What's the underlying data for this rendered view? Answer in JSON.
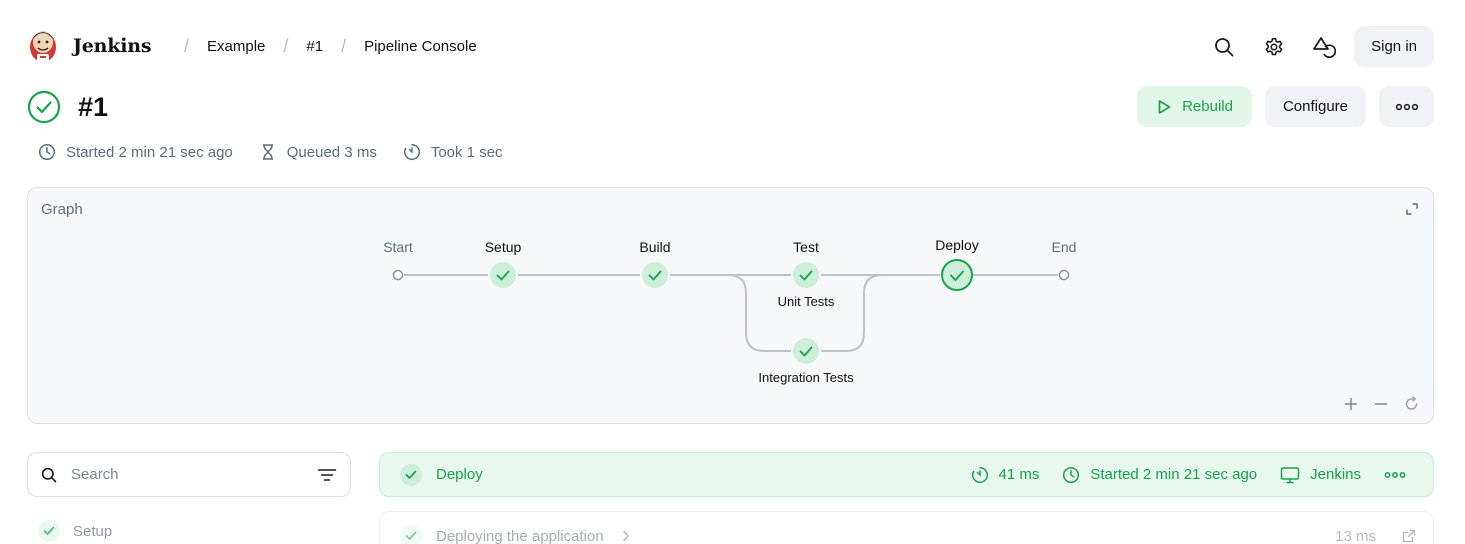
{
  "brand": {
    "name": "Jenkins"
  },
  "breadcrumbs": [
    "Example",
    "#1",
    "Pipeline Console"
  ],
  "header": {
    "sign_in_label": "Sign in"
  },
  "build": {
    "title": "#1",
    "started": "Started 2 min 21 sec ago",
    "queued": "Queued 3 ms",
    "took": "Took 1 sec",
    "rebuild_label": "Rebuild",
    "configure_label": "Configure"
  },
  "graph": {
    "label": "Graph",
    "nodes": {
      "start": "Start",
      "setup": "Setup",
      "build": "Build",
      "test": "Test",
      "unit_tests": "Unit Tests",
      "integration_tests": "Integration Tests",
      "deploy": "Deploy",
      "end": "End"
    }
  },
  "sidebar": {
    "search_placeholder": "Search",
    "stages": [
      {
        "label": "Setup"
      }
    ]
  },
  "stage_detail": {
    "name": "Deploy",
    "duration": "41 ms",
    "started": "Started 2 min 21 sec ago",
    "agent": "Jenkins",
    "steps": [
      {
        "label": "Deploying the application",
        "duration": "13 ms"
      }
    ]
  },
  "colors": {
    "success": "#17a34a",
    "success_bg": "#e3f6ea",
    "muted_text": "#5b6d80",
    "edge": "#b9c2cd"
  }
}
